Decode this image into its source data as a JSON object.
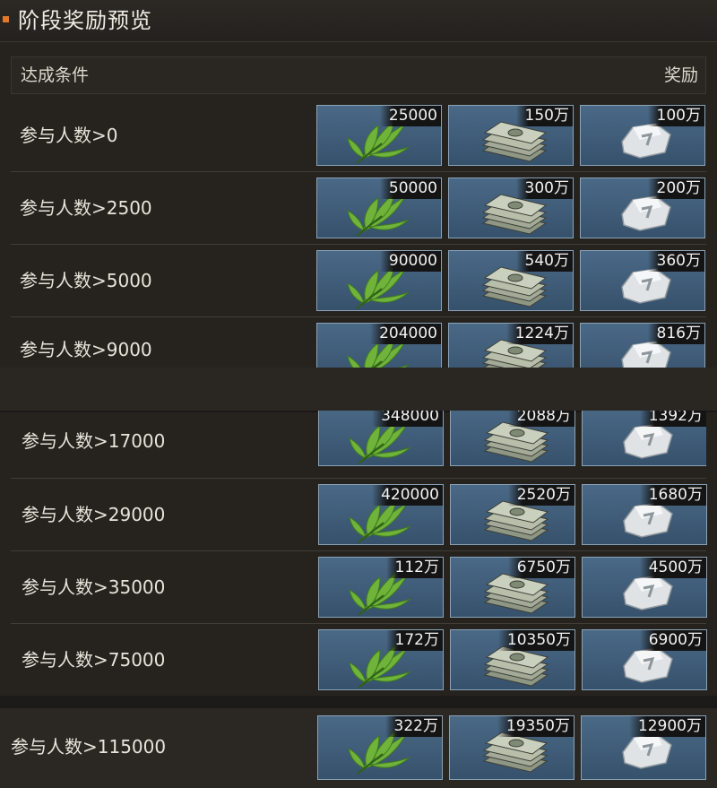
{
  "title": "阶段奖励预览",
  "header": {
    "condition_label": "达成条件",
    "reward_label": "奖励"
  },
  "icons": {
    "leaf": "leaf-icon",
    "cash": "cash-stack-icon",
    "silver": "silver-ingot-icon"
  },
  "rows": [
    {
      "condition": "参与人数>0",
      "leaf": "25000",
      "cash": "150万",
      "silver": "100万"
    },
    {
      "condition": "参与人数>2500",
      "leaf": "50000",
      "cash": "300万",
      "silver": "200万"
    },
    {
      "condition": "参与人数>5000",
      "leaf": "90000",
      "cash": "540万",
      "silver": "360万"
    },
    {
      "condition": "参与人数>9000",
      "leaf": "204000",
      "cash": "1224万",
      "silver": "816万"
    },
    {
      "condition": "参与人数>17000",
      "leaf": "348000",
      "cash": "2088万",
      "silver": "1392万"
    },
    {
      "condition": "参与人数>29000",
      "leaf": "420000",
      "cash": "2520万",
      "silver": "1680万"
    },
    {
      "condition": "参与人数>35000",
      "leaf": "112万",
      "cash": "6750万",
      "silver": "4500万"
    },
    {
      "condition": "参与人数>75000",
      "leaf": "172万",
      "cash": "10350万",
      "silver": "6900万"
    },
    {
      "condition": "参与人数>115000",
      "leaf": "322万",
      "cash": "19350万",
      "silver": "12900万"
    }
  ]
}
